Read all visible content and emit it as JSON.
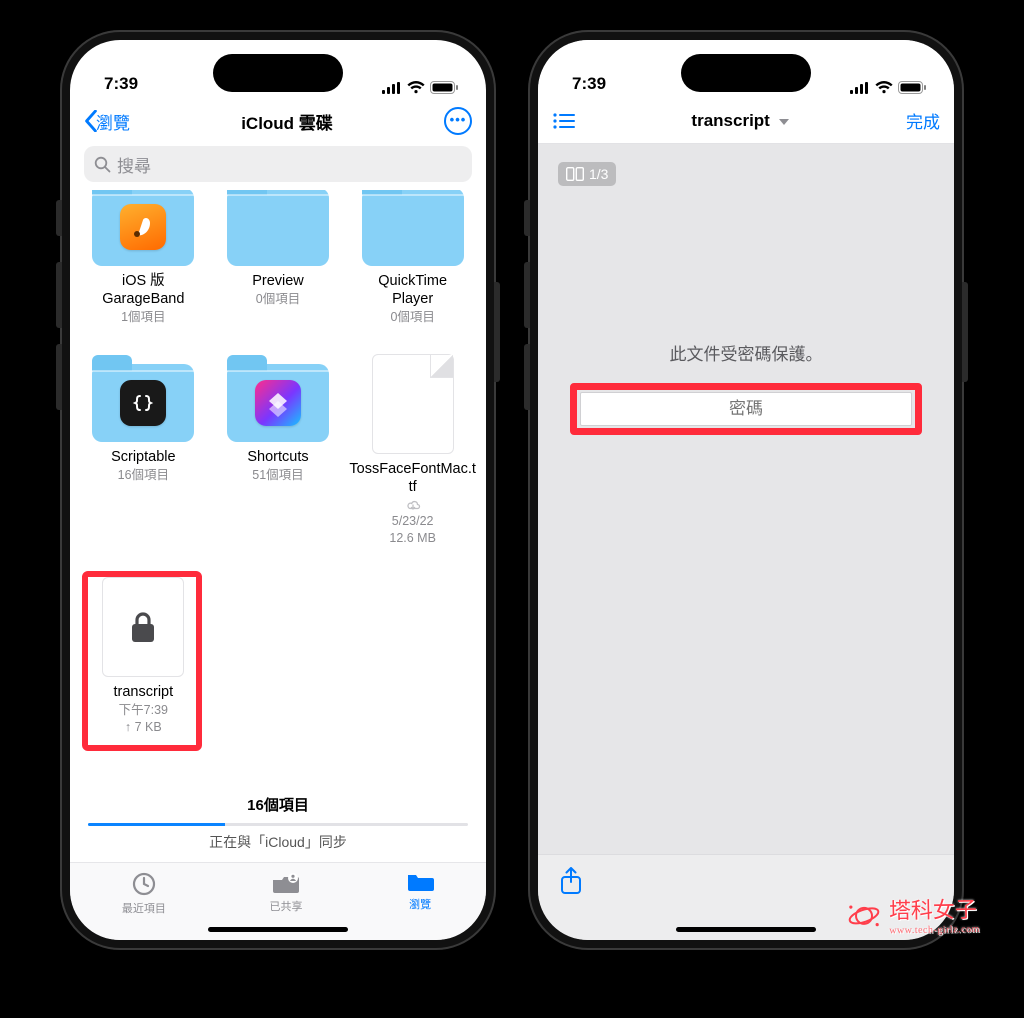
{
  "status": {
    "time": "7:39"
  },
  "colors": {
    "accent": "#007aff",
    "highlight": "#ff2b3b"
  },
  "phone1": {
    "nav": {
      "back_label": "瀏覽",
      "title": "iCloud 雲碟"
    },
    "search": {
      "placeholder": "搜尋"
    },
    "items": [
      {
        "name": "iOS 版\nGarageBand",
        "meta": "1個項目",
        "kind": "folder",
        "app": "garageband"
      },
      {
        "name": "Preview",
        "meta": "0個項目",
        "kind": "folder"
      },
      {
        "name": "QuickTime\nPlayer",
        "meta": "0個項目",
        "kind": "folder"
      },
      {
        "name": "Scriptable",
        "meta": "16個項目",
        "kind": "folder",
        "app": "scriptable"
      },
      {
        "name": "Shortcuts",
        "meta": "51個項目",
        "kind": "folder",
        "app": "shortcuts"
      },
      {
        "name": "TossFaceFontMac.ttf",
        "meta": "5/23/22\n12.6 MB",
        "kind": "file",
        "cloud": true
      },
      {
        "name": "transcript",
        "meta": "下午7:39\n↑ 7 KB",
        "kind": "file",
        "locked": true,
        "highlight": true
      }
    ],
    "footer": {
      "count_label": "16個項目",
      "sync_label": "正在與「iCloud」同步"
    },
    "tabs": [
      {
        "label": "最近項目",
        "icon": "clock-icon",
        "active": false
      },
      {
        "label": "已共享",
        "icon": "shared-icon",
        "active": false
      },
      {
        "label": "瀏覽",
        "icon": "folder-icon",
        "active": true
      }
    ]
  },
  "phone2": {
    "nav": {
      "title": "transcript",
      "done_label": "完成"
    },
    "page_indicator": "1/3",
    "protected_label": "此文件受密碼保護。",
    "password_placeholder": "密碼"
  },
  "watermark": {
    "text": "塔科女子",
    "sub": "www.tech-girlz.com"
  }
}
